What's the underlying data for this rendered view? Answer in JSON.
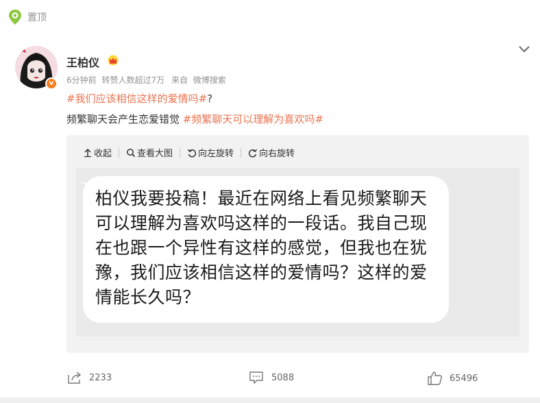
{
  "pin": {
    "label": "置顶"
  },
  "post": {
    "username": "王柏仪",
    "meta": {
      "time": "6分钟前",
      "reposts_note": "转赞人数超过7万",
      "source_label": "来自",
      "source": "微博搜索"
    },
    "line1": {
      "topic": "#我们应该相信这样的爱情吗#",
      "suffix": "?"
    },
    "line2": {
      "text": "频繁聊天会产生恋爱错觉 ",
      "topic": "#频繁聊天可以理解为喜欢吗#"
    },
    "badge": "v"
  },
  "toolbar": {
    "collapse": "收起",
    "view_large": "查看大图",
    "rotate_left": "向左旋转",
    "rotate_right": "向右旋转"
  },
  "image_text": "柏仪我要投稿！最近在网络上看见频繁聊天可以理解为喜欢吗这样的一段话。我自己现在也跟一个异性有这样的感觉，但我也在犹豫，我们应该相信这样的爱情吗？这样的爱情能长久吗？",
  "actions": {
    "share_count": "2233",
    "comment_count": "5088",
    "like_count": "65496"
  },
  "colors": {
    "topic": "#eb7350",
    "meta": "#939393",
    "badge": "#f77d1a"
  },
  "icons": [
    "pin-icon",
    "chevron-down-icon",
    "crown-icon",
    "arrow-up-icon",
    "magnifier-icon",
    "rotate-left-icon",
    "rotate-right-icon",
    "share-icon",
    "comment-icon",
    "like-icon"
  ]
}
